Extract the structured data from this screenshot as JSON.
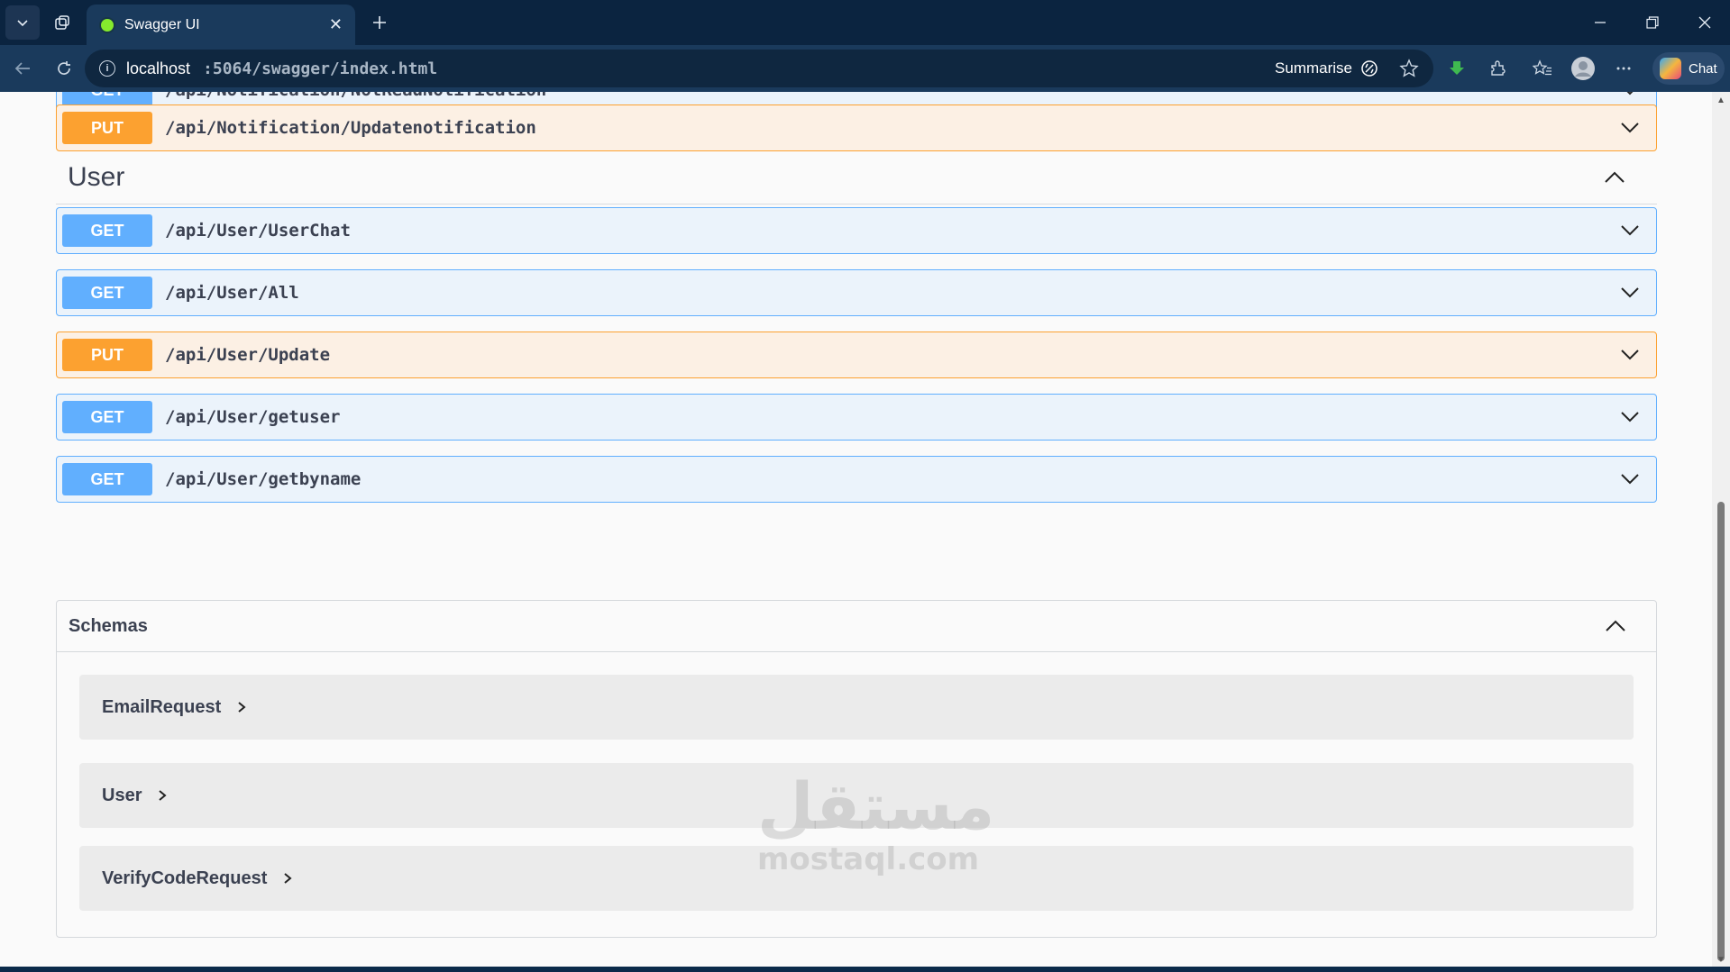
{
  "browser": {
    "tab_title": "Swagger UI",
    "url_host": "localhost",
    "url_path": ":5064/swagger/index.html",
    "summarise_label": "Summarise",
    "chat_label": "Chat"
  },
  "notification_ops": [
    {
      "method": "GET",
      "path": "/api/Notification/NotReadNotification"
    },
    {
      "method": "PUT",
      "path": "/api/Notification/Updatenotification"
    }
  ],
  "user_tag": {
    "name": "User",
    "operations": [
      {
        "method": "GET",
        "path": "/api/User/UserChat"
      },
      {
        "method": "GET",
        "path": "/api/User/All"
      },
      {
        "method": "PUT",
        "path": "/api/User/Update"
      },
      {
        "method": "GET",
        "path": "/api/User/getuser"
      },
      {
        "method": "GET",
        "path": "/api/User/getbyname"
      }
    ]
  },
  "schemas": {
    "title": "Schemas",
    "models": [
      "EmailRequest",
      "User",
      "VerifyCodeRequest"
    ]
  },
  "watermark": {
    "arabic": "مستقل",
    "latin": "mostaql.com"
  },
  "colors": {
    "get": "#61affe",
    "put": "#fca130",
    "browser_frame": "#0b2440"
  }
}
